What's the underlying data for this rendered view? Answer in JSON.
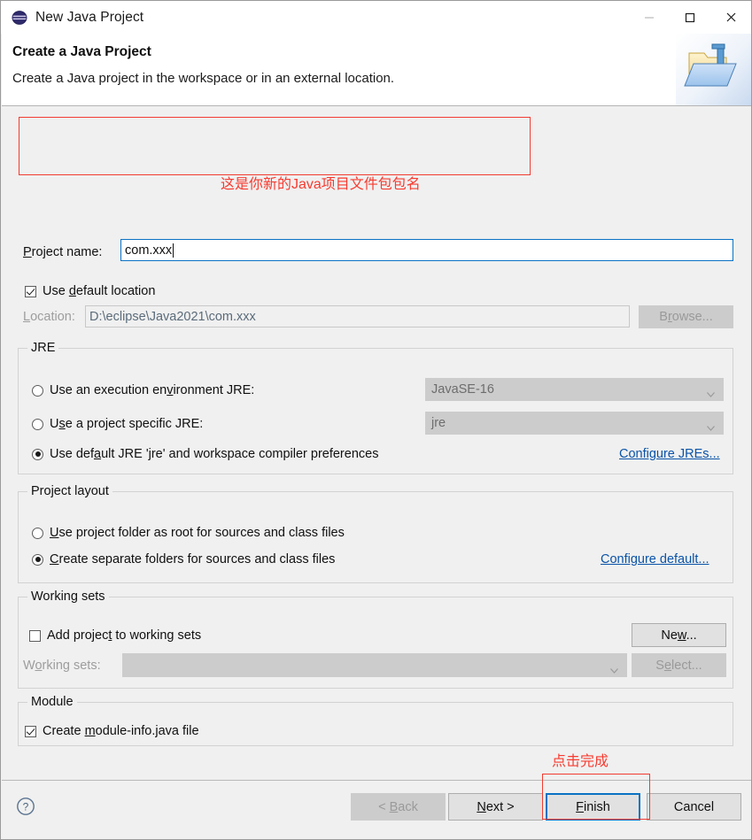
{
  "window": {
    "title": "New Java Project",
    "icon": "eclipse-sphere-icon",
    "controls": {
      "minimize": "–",
      "maximize": "☐",
      "close": "✕"
    }
  },
  "header": {
    "title": "Create a Java Project",
    "subtitle": "Create a Java project in the workspace or in an external location.",
    "icon": "java-project-folder-icon"
  },
  "project": {
    "name_label_pre": "",
    "name_label_mn": "P",
    "name_label_post": "roject name:",
    "name_value": "com.xxx",
    "use_default_location_label_pre": "Use ",
    "use_default_location_mn": "d",
    "use_default_location_post": "efault location",
    "use_default_location_checked": true,
    "location_label_mn": "L",
    "location_label_post": "ocation:",
    "location_value": "D:\\eclipse\\Java2021\\com.xxx",
    "browse_label_pre": "B",
    "browse_label_mn": "r",
    "browse_label_post": "owse..."
  },
  "jre": {
    "group_title": "JRE",
    "option_exec_pre": "Use an execution en",
    "option_exec_mn": "v",
    "option_exec_post": "ironment JRE:",
    "option_exec_selected": false,
    "exec_combo_value": "JavaSE-16",
    "option_specific_pre": "U",
    "option_specific_mn": "s",
    "option_specific_post": "e a project specific JRE:",
    "option_specific_selected": false,
    "specific_combo_value": "jre",
    "option_default_pre": "Use def",
    "option_default_mn": "a",
    "option_default_post": "ult JRE 'jre' and workspace compiler preferences",
    "option_default_selected": true,
    "configure_jres_link": "Configure JREs..."
  },
  "layout": {
    "group_title": "Project layout",
    "option_root_mn": "U",
    "option_root_post": "se project folder as root for sources and class files",
    "option_root_selected": false,
    "option_separate_mn": "C",
    "option_separate_post": "reate separate folders for sources and class files",
    "option_separate_selected": true,
    "configure_default_link": "Configure default..."
  },
  "working_sets": {
    "group_title": "Working sets",
    "add_label_pre": "Add projec",
    "add_label_mn": "t",
    "add_label_post": " to working sets",
    "add_checked": false,
    "new_label_pre": "Ne",
    "new_label_mn": "w",
    "new_label_post": "...",
    "sets_label_pre": "W",
    "sets_label_mn": "o",
    "sets_label_post": "rking sets:",
    "sets_combo_value": "",
    "select_label_pre": "S",
    "select_label_mn": "e",
    "select_label_post": "lect..."
  },
  "module": {
    "group_title": "Module",
    "create_label_pre": "Create ",
    "create_label_mn": "m",
    "create_label_post": "odule-info.java file",
    "create_checked": true
  },
  "footer": {
    "help_icon": "help-question-icon",
    "back_label_pre": "< ",
    "back_label_mn": "B",
    "back_label_post": "ack",
    "back_enabled": false,
    "next_label_pre": "",
    "next_label_mn": "N",
    "next_label_post": "ext >",
    "finish_label_pre": "",
    "finish_label_mn": "F",
    "finish_label_post": "inish",
    "cancel_label": "Cancel"
  },
  "annotations": {
    "project_name_note": "这是你新的Java项目文件包包名",
    "finish_note": "点击完成",
    "color": "#f73b30"
  }
}
